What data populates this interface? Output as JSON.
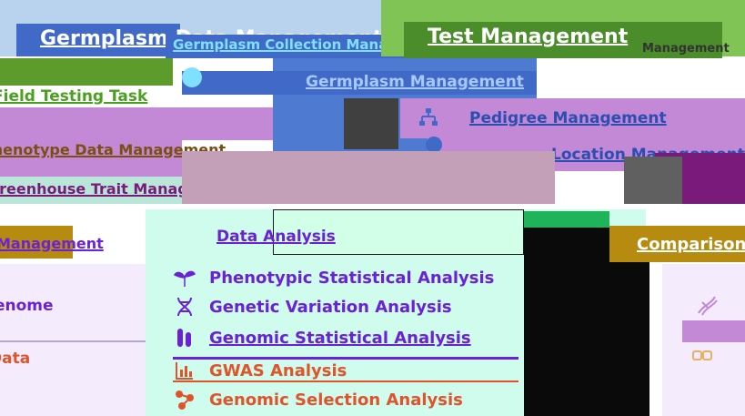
{
  "top_panels": {
    "germplasm_title": "Germplasm Data Management",
    "germplasm_subtitle": "Germplasm Collection Management",
    "test_title": "Test Management",
    "test_subtitle_partial": "Management"
  },
  "menus": {
    "germplasm_management": "Germplasm Management",
    "pedigree_management": "Pedigree Management",
    "location_management": "Location Management",
    "field_testing_task": "Field Testing Task",
    "phenotype_data": "Phenotype Data Management",
    "greenhouse": "Greenhouse Trait Management"
  },
  "bottom_left": {
    "header_partial": "Management",
    "item1_partial": "Genome",
    "item2_partial": "Data"
  },
  "data_analysis": {
    "title": "Data Analysis",
    "items": [
      {
        "label": "Phenotypic Statistical Analysis",
        "icon": "seedling-icon",
        "color": "#6b21d6"
      },
      {
        "label": "Genetic Variation Analysis",
        "icon": "dna-icon",
        "color": "#6b21d6"
      },
      {
        "label": "Genomic Statistical Analysis",
        "icon": "chromosome-icon",
        "color": "#6b21d6"
      },
      {
        "label": "GWAS Analysis",
        "icon": "chart-icon",
        "color": "#e0532b"
      },
      {
        "label": "Genomic Selection Analysis",
        "icon": "molecule-icon",
        "color": "#e0532b"
      }
    ]
  },
  "right_panel": {
    "header_partial": "Comparison"
  },
  "colors": {
    "blue": "#4169c8",
    "light_blue": "#b9d2ee",
    "green": "#7fc454",
    "purple": "#c388d6",
    "dark_purple": "#7a1a7a",
    "gold": "#b78a10",
    "teal_bg": "#cffcec",
    "black": "#0a0a0a"
  }
}
